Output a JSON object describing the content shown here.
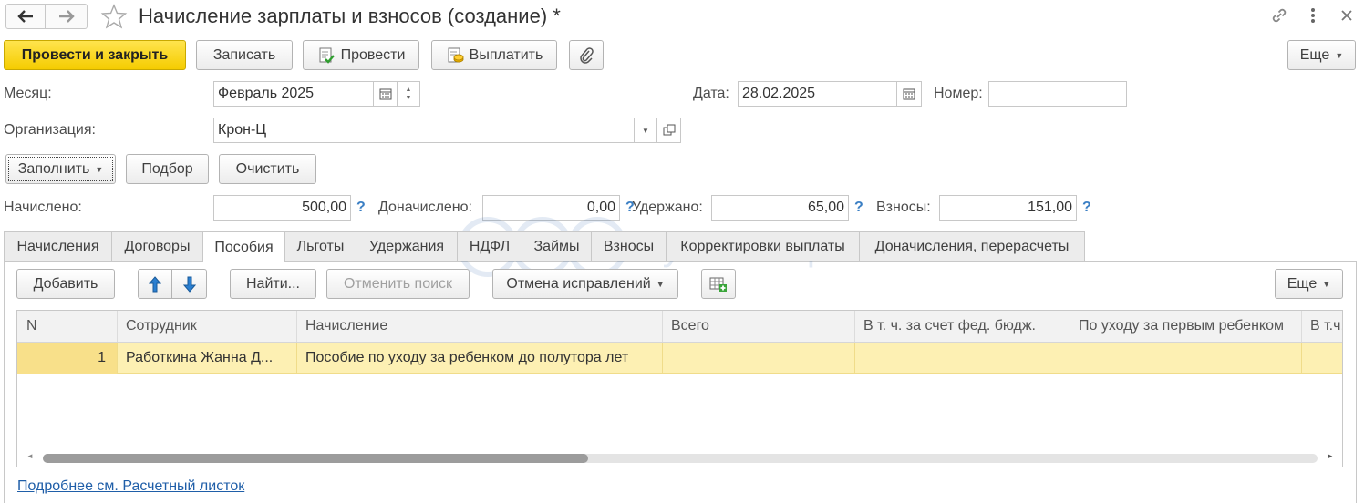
{
  "window": {
    "title": "Начисление зарплаты и взносов (создание) *"
  },
  "toolbar": {
    "post_close": "Провести и закрыть",
    "save": "Записать",
    "post": "Провести",
    "pay": "Выплатить",
    "more": "Еще"
  },
  "fields": {
    "month_label": "Месяц:",
    "month_value": "Февраль 2025",
    "date_label": "Дата:",
    "date_value": "28.02.2025",
    "number_label": "Номер:",
    "number_value": "",
    "org_label": "Организация:",
    "org_value": "Крон-Ц"
  },
  "fill_bar": {
    "fill": "Заполнить",
    "pick": "Подбор",
    "clear": "Очистить"
  },
  "totals": {
    "accrued_label": "Начислено:",
    "accrued_value": "500,00",
    "extra_label": "Доначислено:",
    "extra_value": "0,00",
    "withheld_label": "Удержано:",
    "withheld_value": "65,00",
    "contrib_label": "Взносы:",
    "contrib_value": "151,00",
    "help": "?"
  },
  "tabs": [
    {
      "label": "Начисления"
    },
    {
      "label": "Договоры"
    },
    {
      "label": "Пособия"
    },
    {
      "label": "Льготы"
    },
    {
      "label": "Удержания"
    },
    {
      "label": "НДФЛ"
    },
    {
      "label": "Займы"
    },
    {
      "label": "Взносы"
    },
    {
      "label": "Корректировки выплаты"
    },
    {
      "label": "Доначисления, перерасчеты"
    }
  ],
  "active_tab": "Пособия",
  "tab_toolbar": {
    "add": "Добавить",
    "find": "Найти...",
    "cancel_search": "Отменить поиск",
    "cancel_corrections": "Отмена исправлений",
    "more": "Еще"
  },
  "table": {
    "columns": [
      "N",
      "Сотрудник",
      "Начисление",
      "Всего",
      "В т. ч. за счет фед. бюдж.",
      "По уходу за первым ребенком",
      "В т.ч."
    ],
    "rows": [
      {
        "n": "1",
        "employee": "Работкина Жанна Д...",
        "accrual": "Пособие по уходу за ребенком до полутора лет",
        "total": "",
        "fed": "",
        "first_child": "",
        "incl": ""
      }
    ]
  },
  "watermark": "БухЭксперт",
  "footer_link": "Подробнее см. Расчетный листок",
  "colors": {
    "primary_button": "#f5cc00",
    "selected_row": "#fdf0b3",
    "link": "#1f5ea8",
    "help": "#3b7fc4"
  }
}
